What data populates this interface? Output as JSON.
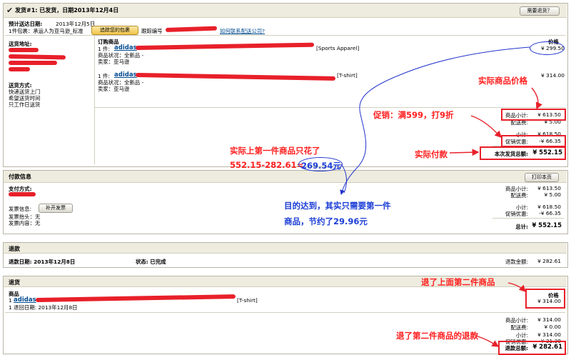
{
  "shipment": {
    "title": "发货#1: 已发货，日期2013年12月4日",
    "help_button": "需要退货？",
    "estimated_label": "预计送达日期:",
    "estimated_date": "2013年12月5日",
    "package_line": "1件包裹：承运人为亚马逊_标准",
    "track_button": "追踪您的包裹",
    "tracking_label": "跟踪编号",
    "contact_link": "如何联系配送公司?",
    "address_label": "送货地址:",
    "method_label": "送货方式:",
    "method_lines": [
      "快递送货上门",
      "希望送货时间",
      "只工作日送货"
    ],
    "items_header": "订购商品",
    "price_header": "价格",
    "items": [
      {
        "qty": "1 件:",
        "brand": "adidas",
        "tag": "[Sports Apparel]",
        "condition": "商品状况：全新品 -",
        "seller": "卖家：亚马逊",
        "price": "¥ 299.50"
      },
      {
        "qty": "1 件:",
        "brand": "adidas",
        "tag": "[T-shirt]",
        "condition": "商品状况：全新品 -",
        "seller": "卖家：亚马逊",
        "price": "¥ 314.00"
      }
    ],
    "summary": [
      {
        "label": "商品小计:",
        "value": "¥ 613.50"
      },
      {
        "label": "配送费:",
        "value": "¥ 5.00"
      },
      {
        "label": "小计:",
        "value": "¥ 618.50"
      },
      {
        "label": "促销优惠:",
        "value": "-¥ 66.35"
      }
    ],
    "total_label": "本次发货总额:",
    "total_value": "¥ 552.15"
  },
  "payment": {
    "title": "付款信息",
    "print_button": "打印本页",
    "method_label": "支付方式:",
    "invoice_label": "发票信息:",
    "invoice_button": "补开发票",
    "invoice_lines": [
      "发票抬头：无",
      "发票内容：无"
    ],
    "summary": [
      {
        "label": "商品小计:",
        "value": "¥ 613.50"
      },
      {
        "label": "配送费:",
        "value": "¥ 5.00"
      },
      {
        "label": "小计:",
        "value": "¥ 618.50"
      },
      {
        "label": "促销优惠:",
        "value": "-¥ 66.35"
      }
    ],
    "total_label": "总计:",
    "total_value": "¥ 552.15"
  },
  "refund": {
    "title": "退款",
    "date_label": "退款日期: 2013年12月8日",
    "status_label": "状态: 已完成",
    "amount_label": "退款金额:",
    "amount_value": "¥ 282.61"
  },
  "return": {
    "title": "退货",
    "item_header": "商品",
    "price_header": "价格",
    "item_qty": "1",
    "item_brand": "adidas",
    "item_tag": "[T-shirt]",
    "return_date": "1 退回日期:   2013年12月8日",
    "item_price": "¥ 314.00",
    "summary": [
      {
        "label": "商品小计:",
        "value": "¥ 314.00"
      },
      {
        "label": "配送费:",
        "value": "¥ 0.00"
      },
      {
        "label": "小计:",
        "value": "¥ 314.00"
      },
      {
        "label": "促销优惠:",
        "value": "-¥ 31.39"
      }
    ],
    "total_label": "退款总额:",
    "total_value": "¥ 282.61"
  },
  "annotations": {
    "actual_price": "实际商品价格",
    "promo": "促销：满599，打9折",
    "actual_pay": "实际付款",
    "first_item_cost": "实际上第一件商品只花了",
    "calc_prefix": "552.15-282.61=",
    "calc_result": "269.54元",
    "goal_line1": "目的达到，其实只需要第一件",
    "goal_line2": "商品，节约了29.96元",
    "returned_item": "退了上面第二件商品",
    "returned_refund": "退了第二件商品的退款"
  },
  "colors": {
    "annotation_red": "#ff2020",
    "annotation_blue": "#1c3ed6",
    "header_bar": "#eeecdf"
  }
}
